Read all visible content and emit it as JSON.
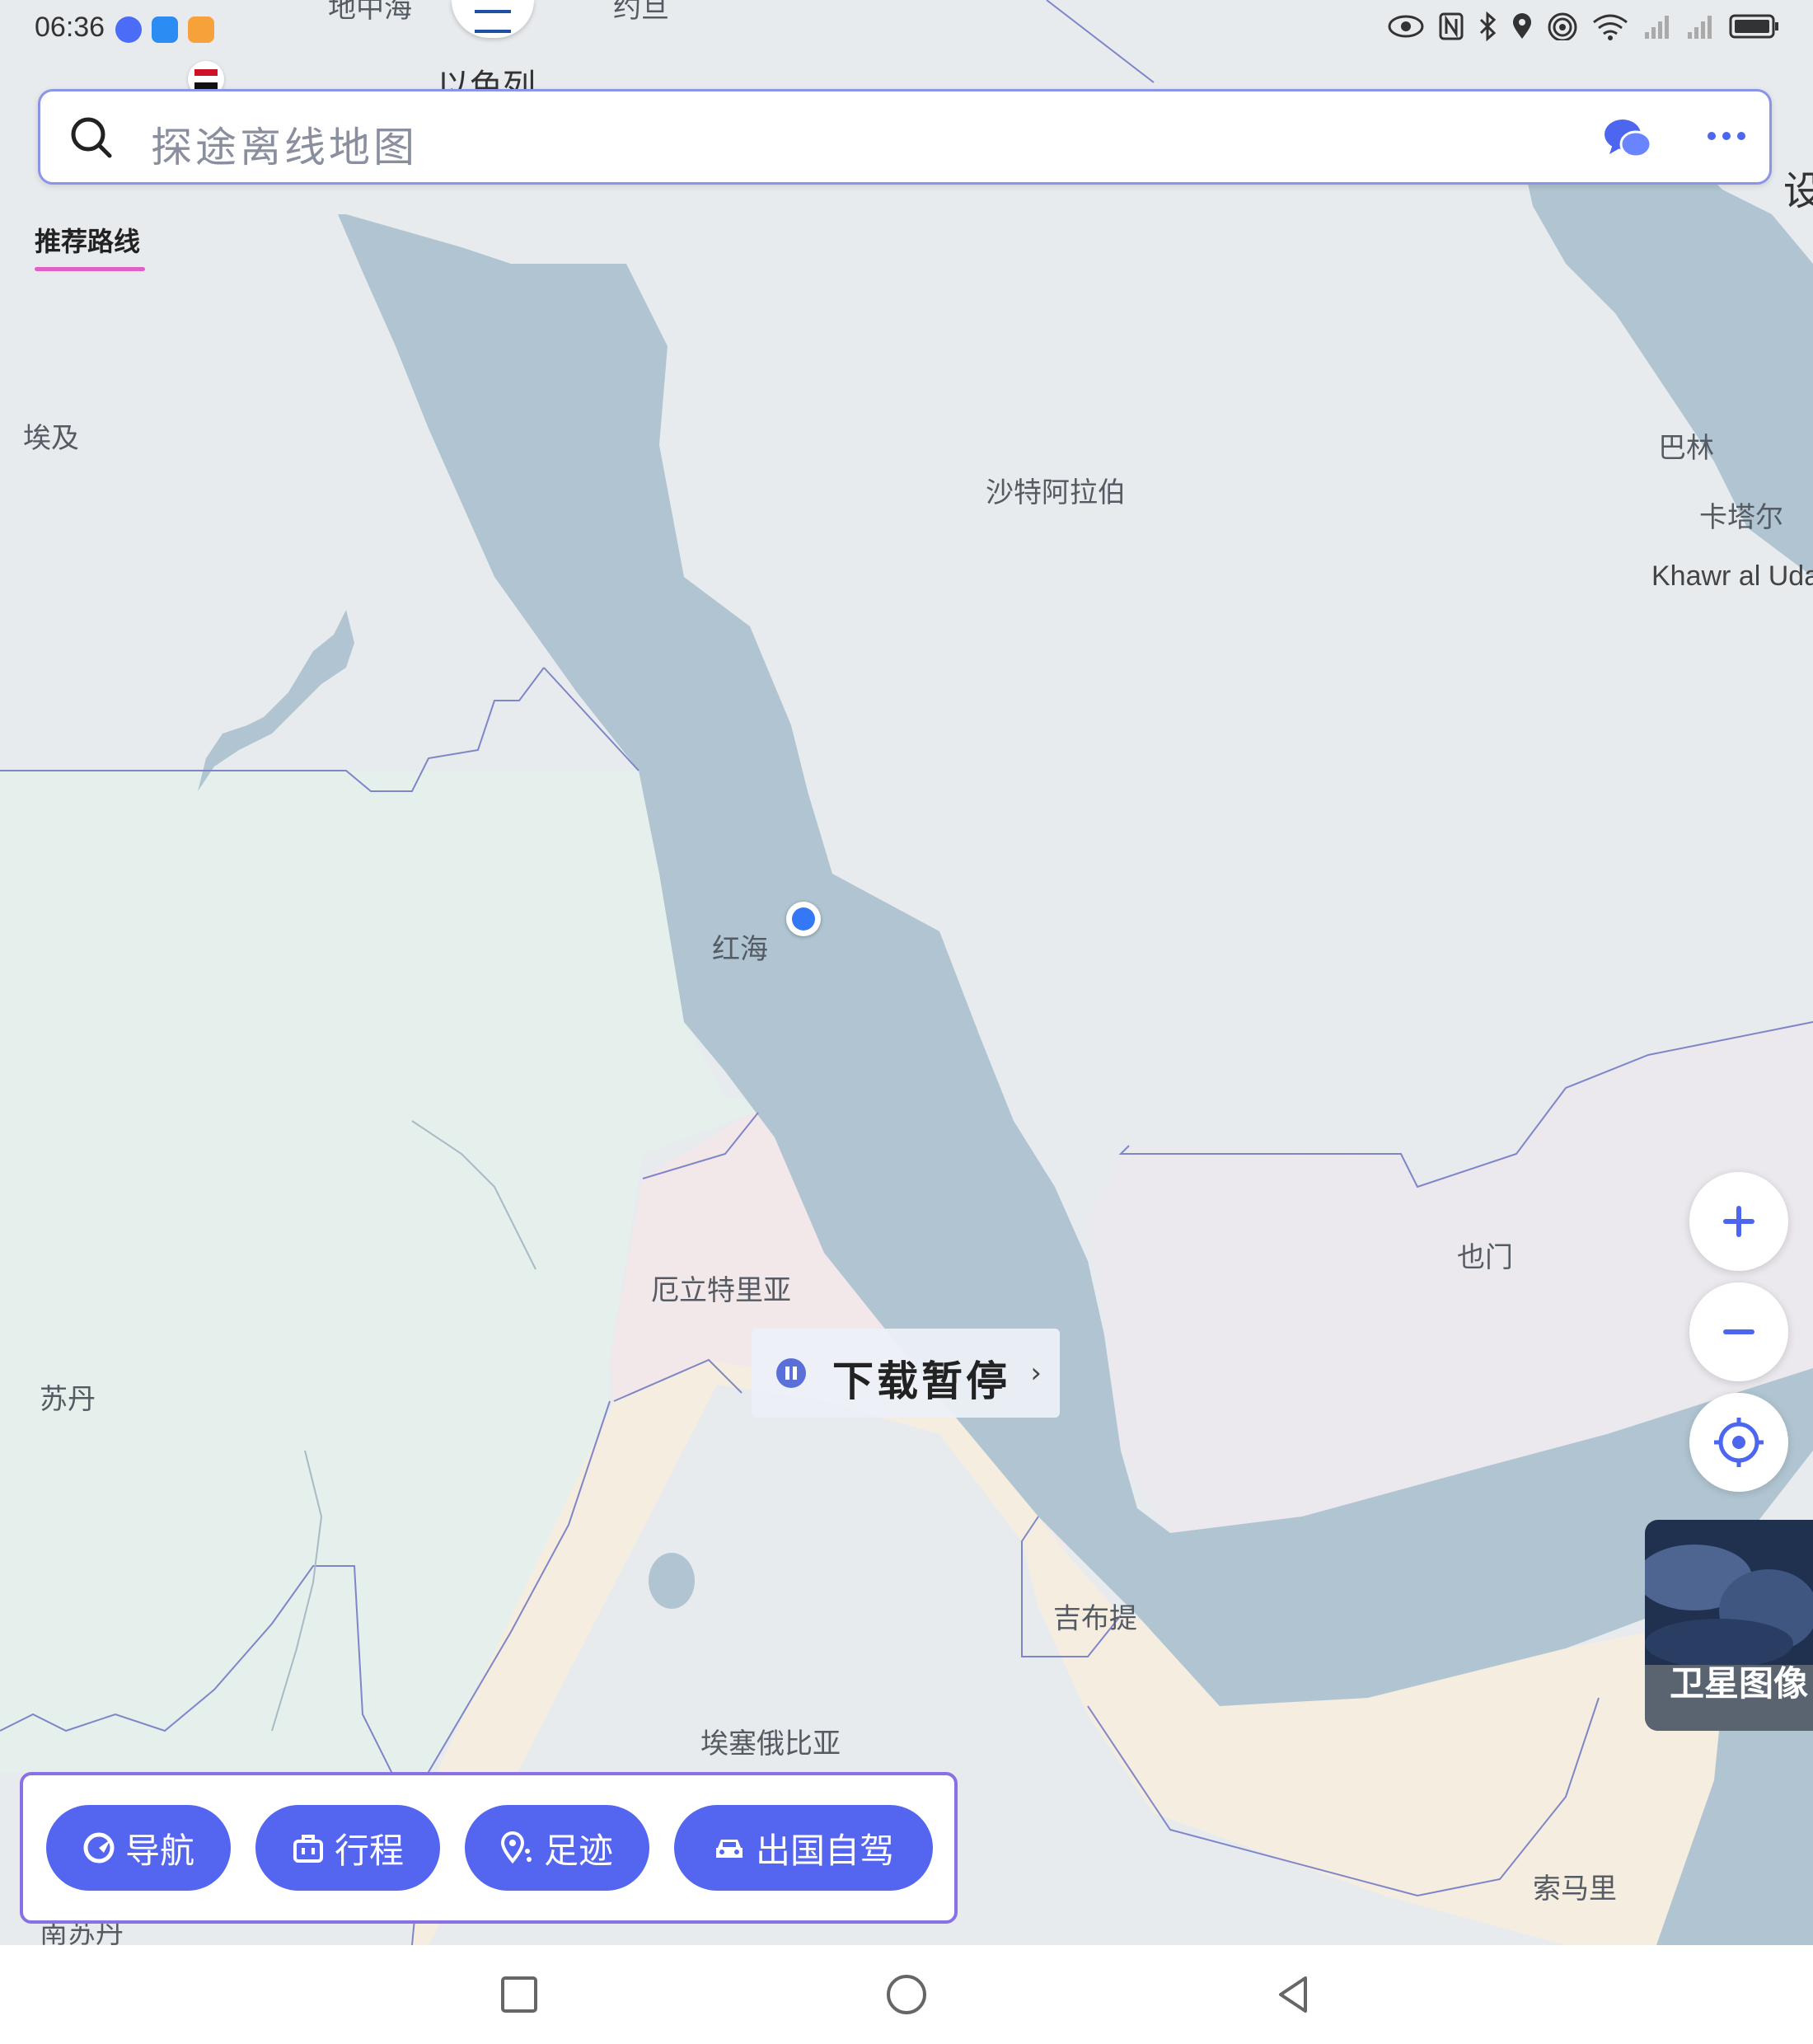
{
  "status_bar": {
    "time": "06:36"
  },
  "search": {
    "placeholder": "探途离线地图"
  },
  "tabs": [
    {
      "label": "推荐路线"
    }
  ],
  "map_labels": {
    "mediterranean": "地中海",
    "israel": "以色列",
    "jordan": "约旦",
    "egypt": "埃及",
    "saudi": "沙特阿拉伯",
    "bahrain": "巴林",
    "qatar": "卡塔尔",
    "khawr": "Khawr al Uda",
    "settings_edge": "设",
    "red_sea": "红海",
    "sudan": "苏丹",
    "eritrea": "厄立特里亚",
    "yemen": "也门",
    "djibouti": "吉布提",
    "ethiopia": "埃塞俄比亚",
    "somalia": "索马里",
    "south_sudan": "南苏丹"
  },
  "download_status": {
    "label": "下载暂停"
  },
  "satellite": {
    "label": "卫星图像"
  },
  "actions": [
    {
      "label": "导航",
      "icon": "navigation-icon"
    },
    {
      "label": "行程",
      "icon": "luggage-icon"
    },
    {
      "label": "足迹",
      "icon": "footprint-pin-icon"
    },
    {
      "label": "出国自驾",
      "icon": "car-icon"
    }
  ],
  "colors": {
    "accent": "#5466f0",
    "sea": "#b0c5d1",
    "land": "#e8ebee",
    "sudan_land": "#e5efec",
    "ethiopia_land": "#f5ede0",
    "eritrea_land": "#f2e7e9",
    "yemen_land": "#ebe8ee"
  }
}
